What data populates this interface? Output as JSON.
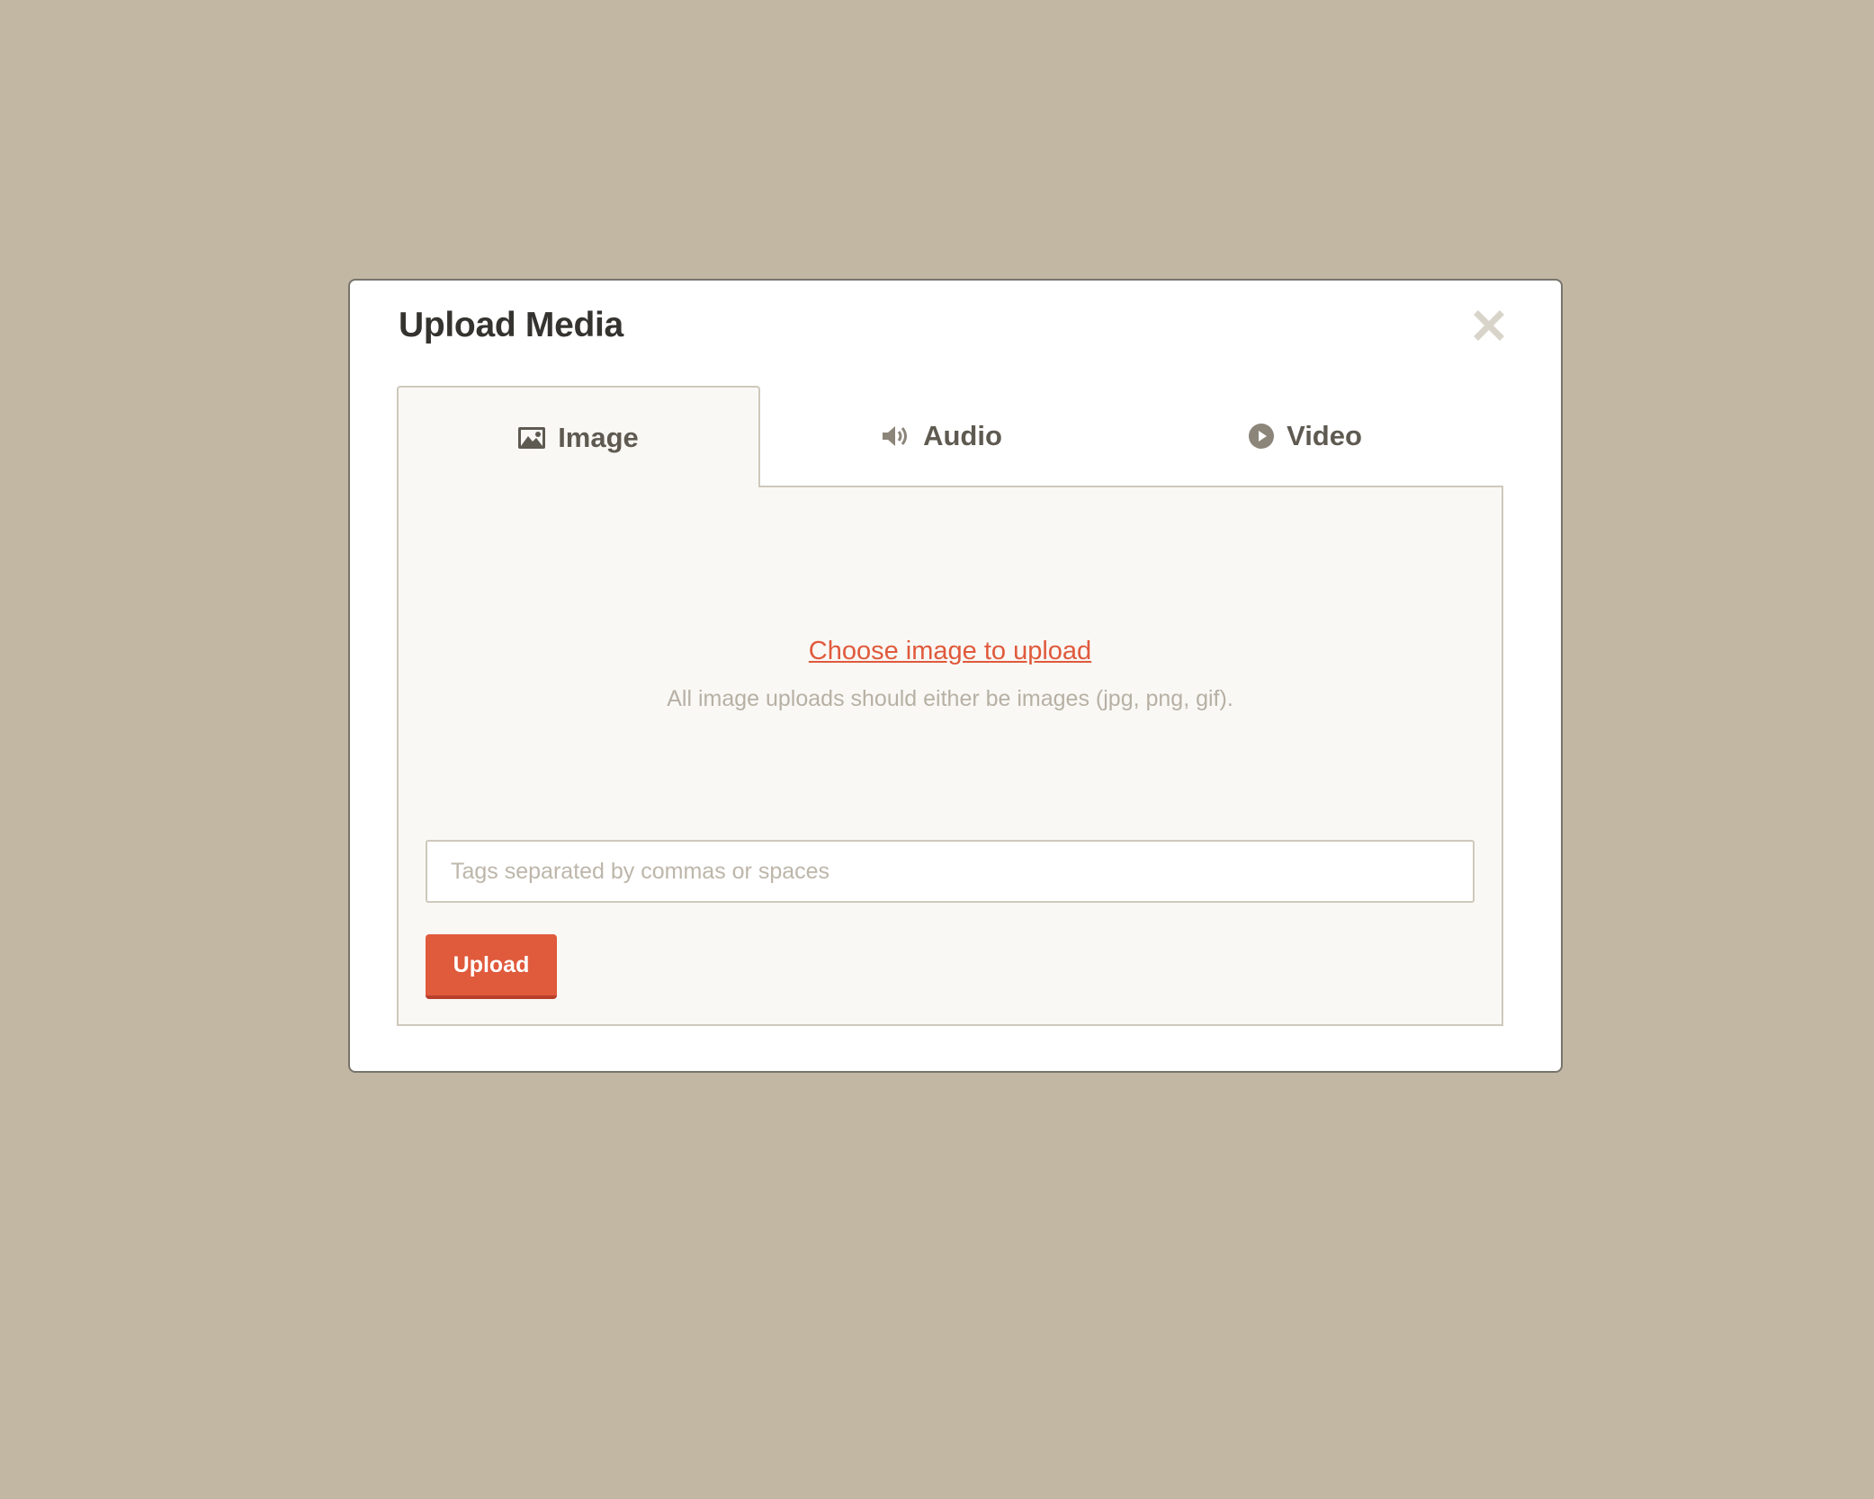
{
  "modal": {
    "title": "Upload Media",
    "close_icon": "close-x-icon"
  },
  "tabs": [
    {
      "label": "Image",
      "icon": "image-icon",
      "active": true
    },
    {
      "label": "Audio",
      "icon": "speaker-icon",
      "active": false
    },
    {
      "label": "Video",
      "icon": "play-circle-icon",
      "active": false
    }
  ],
  "panel": {
    "choose_link": "Choose image to upload",
    "hint": "All image uploads should either be images (jpg, png, gif).",
    "tags_placeholder": "Tags separated by commas or spaces",
    "tags_value": "",
    "upload_label": "Upload"
  },
  "colors": {
    "background": "#c2b7a3",
    "accent": "#e05a3c",
    "panel": "#f9f8f5",
    "border": "#cfc9bb",
    "title": "#35332f"
  }
}
